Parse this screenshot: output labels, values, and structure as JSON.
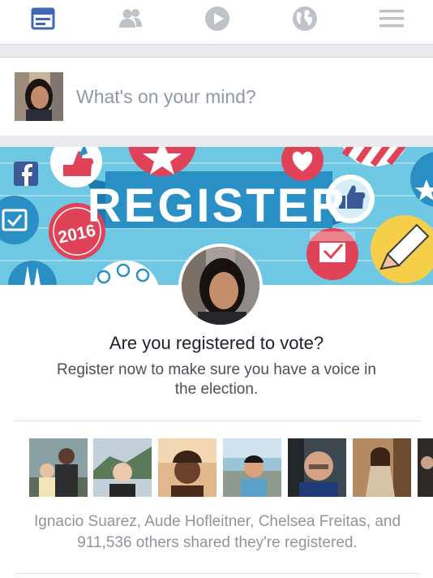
{
  "nav": {
    "items": [
      {
        "icon": "news-feed-icon",
        "active": true
      },
      {
        "icon": "friends-icon",
        "active": false
      },
      {
        "icon": "video-icon",
        "active": false
      },
      {
        "icon": "globe-icon",
        "active": false
      },
      {
        "icon": "menu-icon",
        "active": false
      }
    ],
    "active_color": "#4267b2",
    "inactive_color": "#bec2c9"
  },
  "composer": {
    "placeholder": "What's on your mind?"
  },
  "banner": {
    "headline": "REGISTER",
    "year_badge": "2016",
    "brand_logo": "facebook-logo"
  },
  "card": {
    "question": "Are you registered to vote?",
    "subtext": "Register now to make sure you have a voice in the election."
  },
  "friends": {
    "photo_count_visible": 7,
    "shared_text": "Ignacio Suarez, Aude Hofleitner, Chelsea Freitas, and 911,536 others shared they're registered."
  },
  "colors": {
    "brand_blue": "#3b5998",
    "banner_sky": "#6ec7e3",
    "ribbon": "#2a8fc4",
    "badge_red": "#e04257",
    "badge_yellow": "#f6cf4a"
  }
}
